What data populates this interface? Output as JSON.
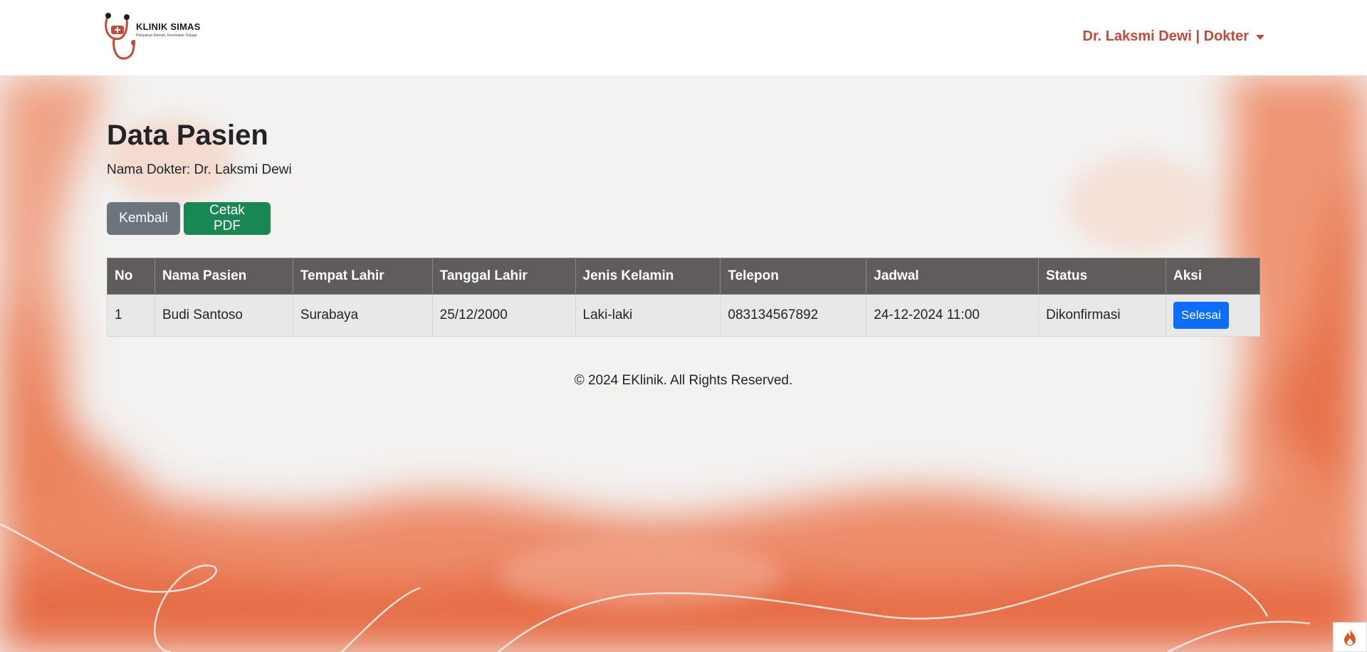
{
  "brand": {
    "name": "KLINIK SIMAS",
    "tagline": "Pelayanan Ramah, Kesehatan Terjaga"
  },
  "user_menu": {
    "label": "Dr. Laksmi Dewi | Dokter"
  },
  "page": {
    "title": "Data Pasien",
    "doctor_line": "Nama Dokter: Dr. Laksmi Dewi"
  },
  "actions": {
    "back_label": "Kembali",
    "pdf_label": "Cetak PDF"
  },
  "table": {
    "headers": [
      "No",
      "Nama Pasien",
      "Tempat Lahir",
      "Tanggal Lahir",
      "Jenis Kelamin",
      "Telepon",
      "Jadwal",
      "Status",
      "Aksi"
    ],
    "rows": [
      {
        "no": "1",
        "name": "Budi Santoso",
        "birthplace": "Surabaya",
        "birthdate": "25/12/2000",
        "gender": "Laki-laki",
        "phone": "083134567892",
        "schedule": "24-12-2024 11:00",
        "status": "Dikonfirmasi",
        "action_label": "Selesai"
      }
    ]
  },
  "footer": {
    "text": "© 2024 EKlinik. All Rights Reserved."
  },
  "colors": {
    "accent": "#c54a34",
    "table_header": "#5f5c5b",
    "btn_back": "#6c757d",
    "btn_pdf": "#198754",
    "btn_done": "#0d6efd"
  }
}
